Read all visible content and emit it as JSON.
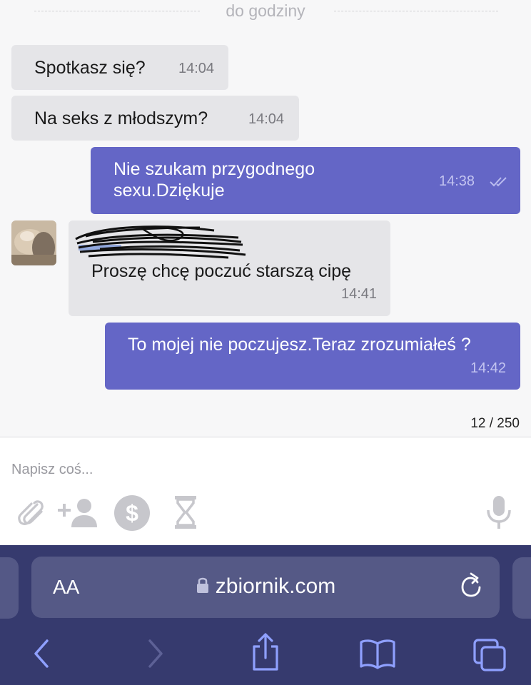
{
  "divider": {
    "label": "do godziny"
  },
  "messages": [
    {
      "direction": "in",
      "text": "Spotkasz się?",
      "time": "14:04"
    },
    {
      "direction": "in",
      "text": "Na seks z młodszym?",
      "time": "14:04"
    },
    {
      "direction": "out",
      "text": "Nie szukam przygodnego\nsexu.Dziękuje",
      "time": "14:38",
      "status_icon": "double-check-icon"
    },
    {
      "direction": "in",
      "text": "Proszę chcę poczuć starszą cipę",
      "time": "14:41",
      "sender_name_redacted": true
    },
    {
      "direction": "out",
      "text": "To mojej nie poczujesz.Teraz zrozumiałeś ?",
      "time": "14:42"
    }
  ],
  "composer": {
    "char_counter": "12 / 250",
    "placeholder": "Napisz coś...",
    "tools": [
      "paperclip-icon",
      "add-person-icon",
      "dollar-icon",
      "hourglass-icon",
      "microphone-icon"
    ]
  },
  "browser": {
    "text_size_button": "AA",
    "domain": "zbiornik.com",
    "nav_icons": [
      "back-icon",
      "forward-icon",
      "share-icon",
      "bookmarks-icon",
      "tabs-icon"
    ]
  },
  "colors": {
    "outgoing_bubble": "#6466c6",
    "incoming_bubble": "#e5e5e8",
    "browser_bar": "#363a6e",
    "url_field": "#555986",
    "accent_icon": "#8fa0ff"
  }
}
